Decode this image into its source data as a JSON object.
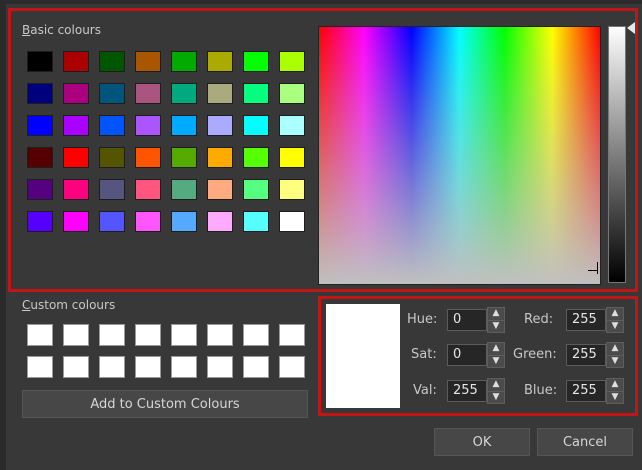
{
  "basic_colours": {
    "label": "Basic colours",
    "rows": [
      [
        "#000000",
        "#aa0000",
        "#005500",
        "#aa5500",
        "#00aa00",
        "#aaaa00",
        "#00ff00",
        "#aaff00"
      ],
      [
        "#00007f",
        "#aa007f",
        "#00557f",
        "#aa557f",
        "#00aa7f",
        "#aaaa7f",
        "#00ff7f",
        "#aaff7f"
      ],
      [
        "#0000ff",
        "#aa00ff",
        "#0055ff",
        "#aa55ff",
        "#00aaff",
        "#aaaaff",
        "#00ffff",
        "#aaffff"
      ],
      [
        "#550000",
        "#ff0000",
        "#555500",
        "#ff5500",
        "#55aa00",
        "#ffaa00",
        "#55ff00",
        "#ffff00"
      ],
      [
        "#55007f",
        "#ff007f",
        "#55557f",
        "#ff557f",
        "#55aa7f",
        "#ffaa7f",
        "#55ff7f",
        "#ffff7f"
      ],
      [
        "#5500ff",
        "#ff00ff",
        "#5555ff",
        "#ff55ff",
        "#55aaff",
        "#ffaaff",
        "#55ffff",
        "#ffffff"
      ]
    ]
  },
  "custom_colours": {
    "label": "Custom colours",
    "rows": [
      [
        "#ffffff",
        "#ffffff",
        "#ffffff",
        "#ffffff",
        "#ffffff",
        "#ffffff",
        "#ffffff",
        "#ffffff"
      ],
      [
        "#ffffff",
        "#ffffff",
        "#ffffff",
        "#ffffff",
        "#ffffff",
        "#ffffff",
        "#ffffff",
        "#ffffff"
      ]
    ]
  },
  "add_button_label": "Add to Custom Colours",
  "current_colour": "#ffffff",
  "fields": {
    "hue": {
      "label": "Hue:",
      "value": "0"
    },
    "sat": {
      "label": "Sat:",
      "value": "0"
    },
    "val": {
      "label": "Val:",
      "value": "255"
    },
    "red": {
      "label": "Red:",
      "value": "255"
    },
    "green": {
      "label": "Green:",
      "value": "255"
    },
    "blue": {
      "label": "Blue:",
      "value": "255"
    }
  },
  "buttons": {
    "ok": "OK",
    "cancel": "Cancel"
  },
  "highlight_color": "#c01616"
}
